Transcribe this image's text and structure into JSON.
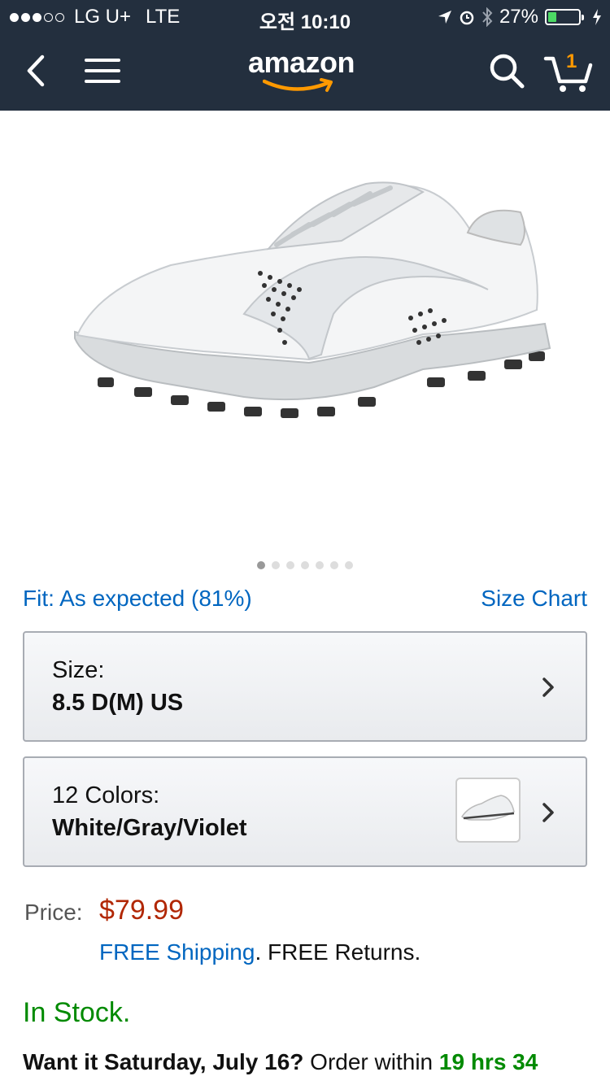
{
  "status_bar": {
    "carrier": "LG U+",
    "network": "LTE",
    "time": "오전 10:10",
    "battery": "27%",
    "battery_level": 0.27
  },
  "nav": {
    "logo": "amazon",
    "cart_count": "1"
  },
  "product": {
    "image_total": 7,
    "image_active_index": 0,
    "fit_text": "Fit: As expected (81%)",
    "size_chart": "Size Chart",
    "size_label": "Size:",
    "size_value": "8.5 D(M) US",
    "color_label": "12 Colors:",
    "color_value": "White/Gray/Violet",
    "price_label": "Price:",
    "price": "$79.99",
    "free_shipping": "FREE Shipping",
    "free_returns": ". FREE Returns.",
    "stock": "In Stock.",
    "delivery_prefix": "Want it Saturday, July 16?",
    "delivery_mid": " Order within ",
    "delivery_time": "19 hrs 34"
  },
  "colors": {
    "header_bg": "#232f3e",
    "accent": "#ff9900",
    "link": "#0066c0",
    "price": "#b12704",
    "in_stock": "#008a00"
  }
}
